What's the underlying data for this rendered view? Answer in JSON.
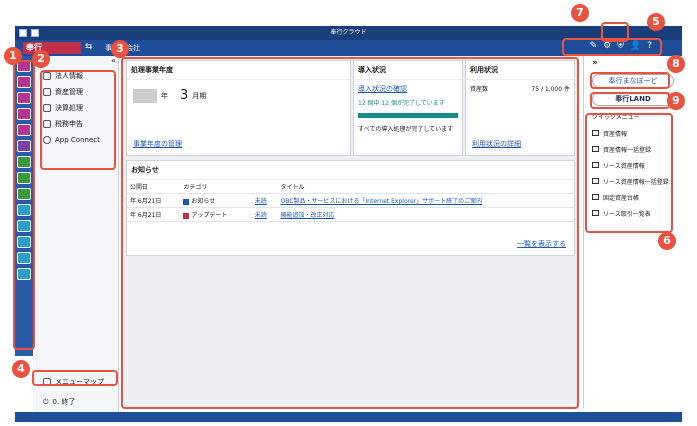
{
  "window": {
    "title": "奉行クラウド"
  },
  "appbar": {
    "logo": "奉行",
    "company": "事株式会社"
  },
  "menu": {
    "items": [
      "法人情報",
      "資産管理",
      "決算処理",
      "税務申告",
      "App Connect"
    ],
    "menumap": "メニューマップ",
    "exit": "0. 終了"
  },
  "panels": {
    "fiscal": {
      "title": "処理事業年度",
      "year_suffix": "年",
      "month_value": "3",
      "month_suffix": "月期",
      "link": "事業年度の管理"
    },
    "install": {
      "title": "導入状況",
      "link": "導入状況の確認",
      "progress": "12 個中 12 個が完了しています",
      "status": "すべての導入処理が完了しています"
    },
    "usage": {
      "title": "利用状況",
      "label": "資産数",
      "value": "75 / 1,000",
      "unit": "件",
      "link": "利用状況の詳細"
    },
    "news": {
      "title": "お知らせ",
      "headers": [
        "公開日",
        "カテゴリ",
        "タイトル"
      ],
      "rows": [
        {
          "date": "年 6月21日",
          "category": "お知らせ",
          "status": "未読",
          "title": "OBC製品・サービスにおける「Internet Explorer」サポート終了のご案内",
          "color": "#1a58b8"
        },
        {
          "date": "年 6月21日",
          "category": "アップデート",
          "status": "未読",
          "title": "機能追加・改正対応",
          "color": "#c0304a"
        }
      ],
      "more": "一覧を表示する"
    }
  },
  "right": {
    "expand": "»",
    "manabo": "奉行まなぼーど",
    "land": "奉行LAND",
    "quick_title": "クイックメニュー",
    "quick": [
      "資産情報",
      "資産情報一括登録",
      "リース資産情報",
      "リース資産情報一括登録",
      "固定資産台帳",
      "リース取引一覧表"
    ]
  },
  "badges": [
    "1",
    "2",
    "3",
    "4",
    "5",
    "6",
    "7",
    "8",
    "9"
  ],
  "colors": {
    "accent": "#e8523f",
    "navy": "#1f4e99"
  }
}
